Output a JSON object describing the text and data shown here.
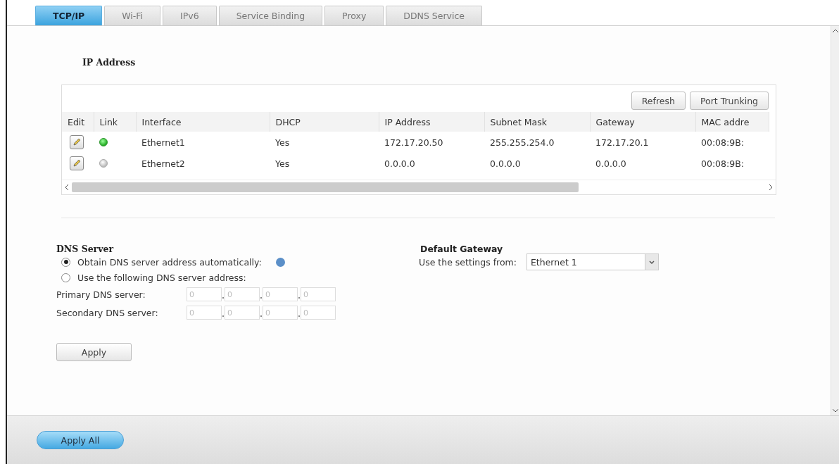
{
  "tabs": [
    {
      "label": "TCP/IP",
      "selected": true
    },
    {
      "label": "Wi-Fi",
      "selected": false
    },
    {
      "label": "IPv6",
      "selected": false
    },
    {
      "label": "Service Binding",
      "selected": false
    },
    {
      "label": "Proxy",
      "selected": false
    },
    {
      "label": "DDNS Service",
      "selected": false
    }
  ],
  "ip_address": {
    "title": "IP Address",
    "buttons": [
      "Refresh",
      "Port Trunking"
    ],
    "columns": [
      "Edit",
      "Link",
      "Interface",
      "DHCP",
      "IP Address",
      "Subnet Mask",
      "Gateway",
      "MAC addre"
    ],
    "rows": [
      {
        "connected": true,
        "interface": "Ethernet1",
        "dhcp": "Yes",
        "ip": "172.17.20.50",
        "subnet": "255.255.254.0",
        "gateway": "172.17.20.1",
        "mac": "00:08:9B:"
      },
      {
        "connected": false,
        "interface": "Ethernet2",
        "dhcp": "Yes",
        "ip": "0.0.0.0",
        "subnet": "0.0.0.0",
        "gateway": "0.0.0.0",
        "mac": "00:08:9B:"
      }
    ]
  },
  "dns_server": {
    "title": "DNS Server",
    "options": [
      {
        "label": "Obtain DNS server address automatically:",
        "selected": true,
        "info": true
      },
      {
        "label": "Use the following DNS server address:",
        "selected": false,
        "info": false
      }
    ],
    "fields": [
      {
        "label": "Primary DNS server:",
        "disabled": true,
        "octets": [
          "0",
          "0",
          "0",
          "0"
        ]
      },
      {
        "label": "Secondary DNS server:",
        "disabled": true,
        "octets": [
          "0",
          "0",
          "0",
          "0"
        ]
      }
    ],
    "apply": "Apply"
  },
  "default_gateway": {
    "title": "Default Gateway",
    "label": "Use the settings from:",
    "value": "Ethernet 1"
  },
  "footer": {
    "apply_all": "Apply All"
  }
}
